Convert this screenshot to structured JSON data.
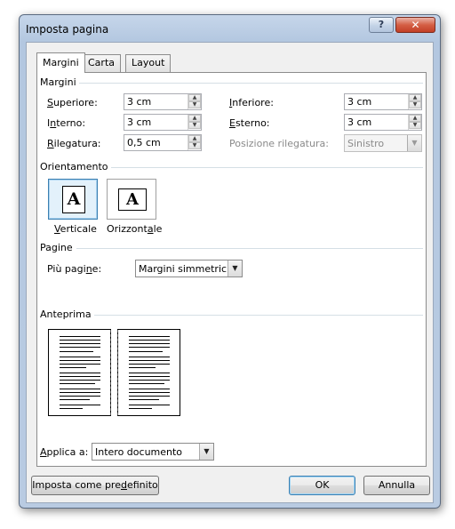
{
  "dialog": {
    "title": "Imposta pagina",
    "help_glyph": "?",
    "close_glyph": "✕"
  },
  "tabs": [
    {
      "label": "Margini",
      "active": true
    },
    {
      "label": "Carta",
      "active": false
    },
    {
      "label": "Layout",
      "active": false
    }
  ],
  "margins": {
    "section_label": "Margini",
    "top_label": "Superiore:",
    "top_value": "3 cm",
    "bottom_label": "Inferiore:",
    "bottom_value": "3 cm",
    "inner_label": "Interno:",
    "inner_value": "3 cm",
    "outer_label": "Esterno:",
    "outer_value": "3 cm",
    "gutter_label": "Rilegatura:",
    "gutter_value": "0,5 cm",
    "gutter_pos_label": "Posizione rilegatura:",
    "gutter_pos_value": "Sinistro"
  },
  "orientation": {
    "section_label": "Orientamento",
    "portrait_label": "Verticale",
    "landscape_label": "Orizzontale",
    "icon_glyph": "A",
    "selected": "portrait"
  },
  "pages": {
    "section_label": "Pagine",
    "multiple_label": "Più pagine:",
    "multiple_value": "Margini simmetrici"
  },
  "preview": {
    "section_label": "Anteprima"
  },
  "apply": {
    "label": "Applica a:",
    "value": "Intero documento"
  },
  "buttons": {
    "set_default": "Imposta come predefinito",
    "ok": "OK",
    "cancel": "Annulla"
  },
  "colors": {
    "accent": "#3c7fb1",
    "close_red": "#c33f26",
    "frame": "#b9cbe2"
  }
}
